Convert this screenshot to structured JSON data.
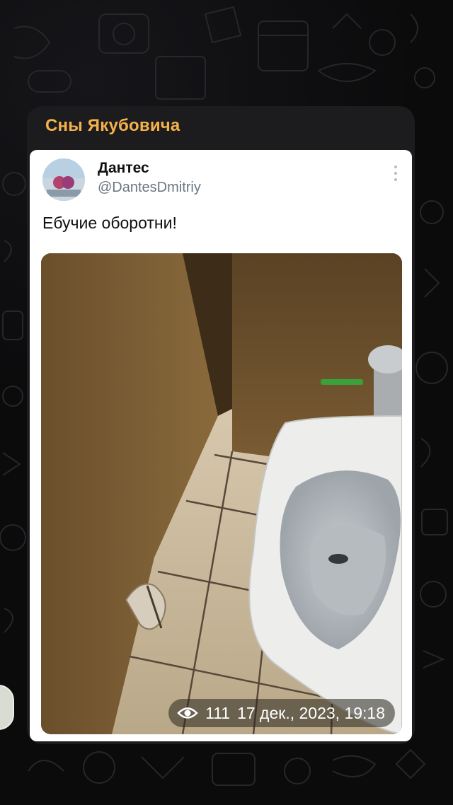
{
  "channel": {
    "name": "Сны Якубовича"
  },
  "tweet": {
    "author_name": "Дантес",
    "author_handle": "@DantesDmitriy",
    "text": "Ебучие оборотни!",
    "more_icon": "vertical-dots-icon"
  },
  "photo": {
    "alt_icon": "photo"
  },
  "message_meta": {
    "views": "111",
    "timestamp": "17 дек., 2023, 19:18",
    "views_icon": "eye-icon"
  },
  "colors": {
    "channel_name": "#f6b24a",
    "bubble_bg": "#1c1c1e",
    "app_bg": "#0b0b0c",
    "handle": "#6b7680"
  }
}
